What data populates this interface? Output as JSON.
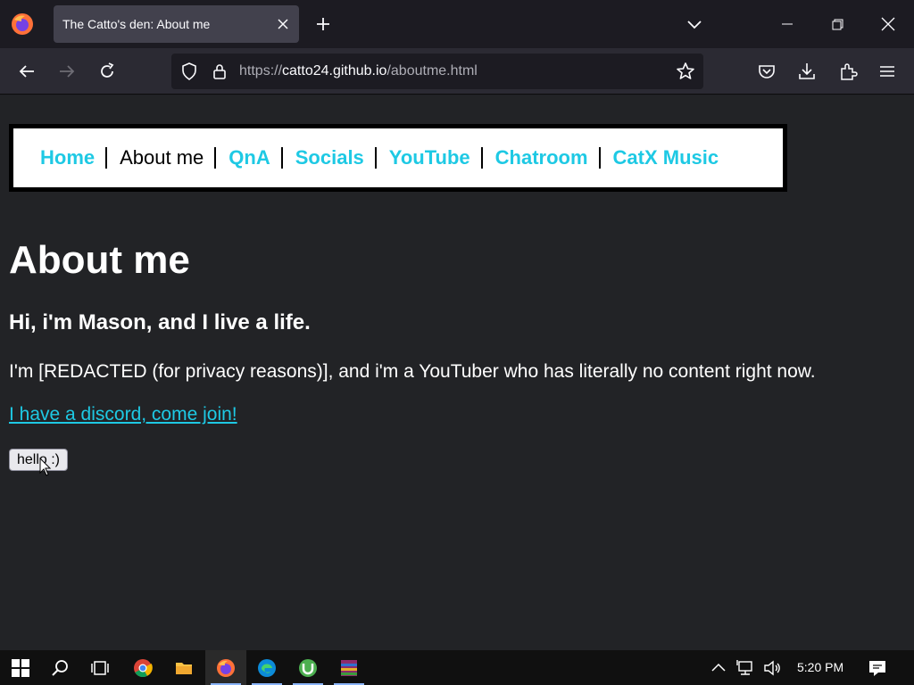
{
  "browser": {
    "tab_title": "The Catto's den: About me",
    "url_prefix": "https://",
    "url_host": "catto24.github.io",
    "url_path": "/aboutme.html"
  },
  "site_nav": {
    "items": [
      {
        "label": "Home",
        "current": false
      },
      {
        "label": "About me",
        "current": true
      },
      {
        "label": "QnA",
        "current": false
      },
      {
        "label": "Socials",
        "current": false
      },
      {
        "label": "YouTube",
        "current": false
      },
      {
        "label": "Chatroom",
        "current": false
      },
      {
        "label": "CatX Music",
        "current": false
      }
    ]
  },
  "content": {
    "title": "About me",
    "subtitle": "Hi, i'm Mason, and I live a life.",
    "intro": "I'm [REDACTED (for privacy reasons)], and i'm a YouTuber who has literally no content right now.",
    "discord_link": "I have a discord, come join!",
    "button_label": "hello :)"
  },
  "taskbar": {
    "apps": [
      "start-icon",
      "search-icon",
      "task-view-icon",
      "chrome-icon",
      "file-explorer-icon",
      "firefox-icon",
      "edge-icon",
      "utorrent-icon",
      "winrar-icon"
    ],
    "active_app": "firefox-icon",
    "clock": "5:20 PM"
  },
  "colors": {
    "page_bg": "#222326",
    "link": "#1ec9e4",
    "browser_chrome": "#1c1b22",
    "toolbar": "#2b2a33",
    "tab_active": "#42414d"
  }
}
